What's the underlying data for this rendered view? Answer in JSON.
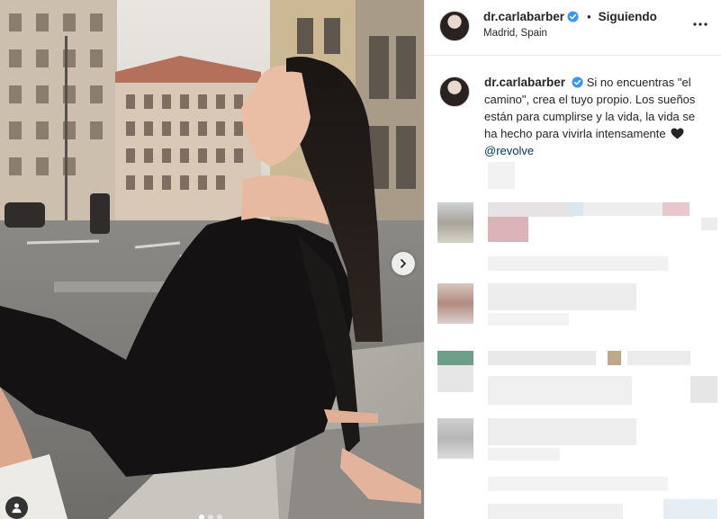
{
  "post": {
    "username": "dr.carlabarber",
    "follow_status": "Siguiendo",
    "separator": "•",
    "location": "Madrid, Spain",
    "caption": "Si no encuentras \"el camino\", crea el tuyo propio. Los sueños están para cumplirse y la vida, la vida se ha hecho para vivirla intensamente",
    "mention": "@revolve",
    "carousel": {
      "total_slides": 3,
      "active_slide": 1
    }
  },
  "icons": {
    "verified": "verified-badge-icon",
    "more": "more-options-icon",
    "next": "chevron-right-icon",
    "user_tag": "user-tag-icon",
    "heart": "black-heart-icon"
  },
  "colors": {
    "verified": "#3897f0",
    "link": "#00376b",
    "text": "#262626",
    "divider": "#efefef"
  }
}
